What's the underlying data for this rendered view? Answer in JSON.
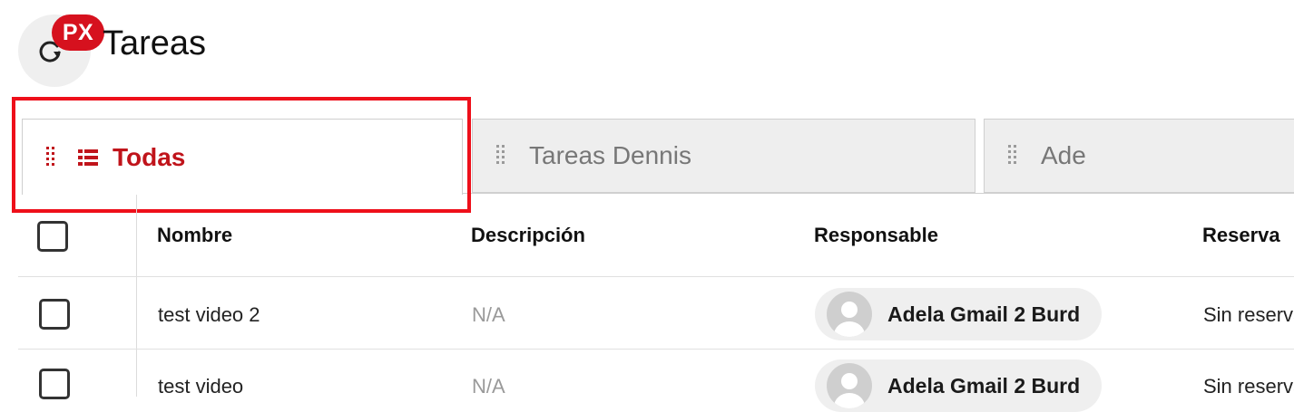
{
  "header": {
    "title": "Tareas",
    "badge": "PX",
    "refresh_icon": "refresh-icon"
  },
  "tabs": [
    {
      "label": "Todas",
      "active": true,
      "icon": "list-icon"
    },
    {
      "label": "Tareas Dennis",
      "active": false
    },
    {
      "label": "Ade",
      "active": false
    }
  ],
  "table": {
    "columns": [
      "Nombre",
      "Descripción",
      "Responsable",
      "Reserva"
    ],
    "rows": [
      {
        "nombre": "test video 2",
        "descripcion": "N/A",
        "responsable": "Adela Gmail 2 Burd",
        "reserva": "Sin reserva"
      },
      {
        "nombre": "test video",
        "descripcion": "N/A",
        "responsable": "Adela Gmail 2 Burd",
        "reserva": "Sin reserva"
      }
    ]
  },
  "colors": {
    "accent": "#c0141b",
    "highlight": "#ee0f1a",
    "badge": "#d6111e"
  }
}
